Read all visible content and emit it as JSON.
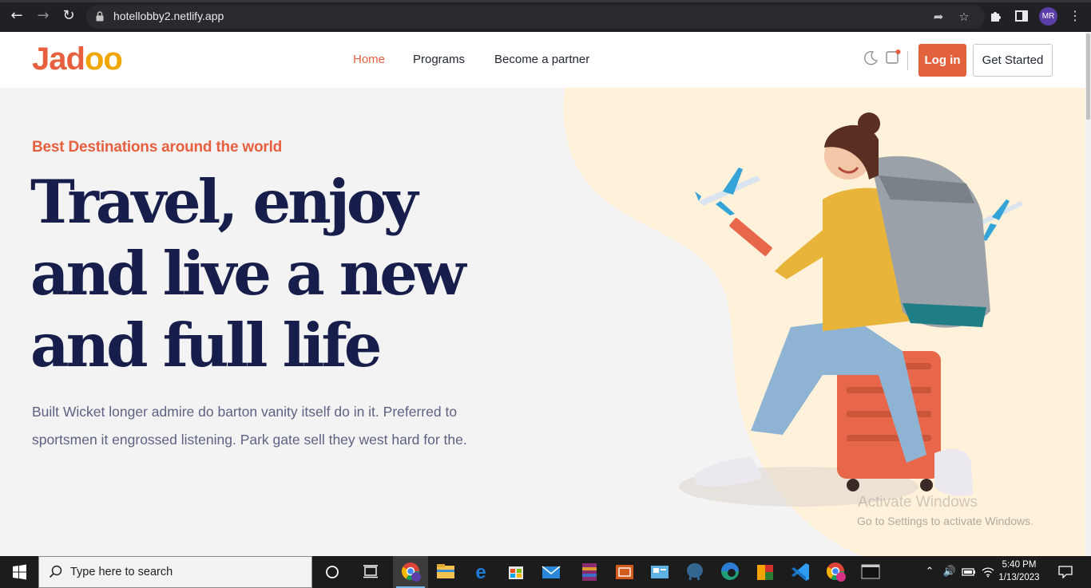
{
  "browser": {
    "url": "hotellobby2.netlify.app",
    "profile_initials": "MR"
  },
  "site": {
    "logo": {
      "main": "Jad",
      "accent": "oo"
    },
    "nav": [
      {
        "label": "Home",
        "active": true
      },
      {
        "label": "Programs",
        "active": false
      },
      {
        "label": "Become a partner",
        "active": false
      }
    ],
    "login_label": "Log in",
    "get_started_label": "Get Started"
  },
  "hero": {
    "eyebrow": "Best Destinations around the world",
    "headline_line1": "Travel, enjoy",
    "headline_line2": "and live a new",
    "headline_line3": "and full life",
    "lead_line1": "Built Wicket longer admire do barton vanity itself do in it. Preferred to",
    "lead_line2": "sportsmen it engrossed listening. Park gate sell they west hard for the."
  },
  "windows_watermark": {
    "title": "Activate Windows",
    "subtitle": "Go to Settings to activate Windows."
  },
  "taskbar": {
    "search_placeholder": "Type here to search",
    "time": "5:40 PM",
    "date": "1/13/2023"
  },
  "colors": {
    "brand": "#e6603f",
    "brand_accent": "#f1a501",
    "headline": "#181e4b",
    "body_text": "#5e6282",
    "hero_blob": "#fff1da"
  }
}
